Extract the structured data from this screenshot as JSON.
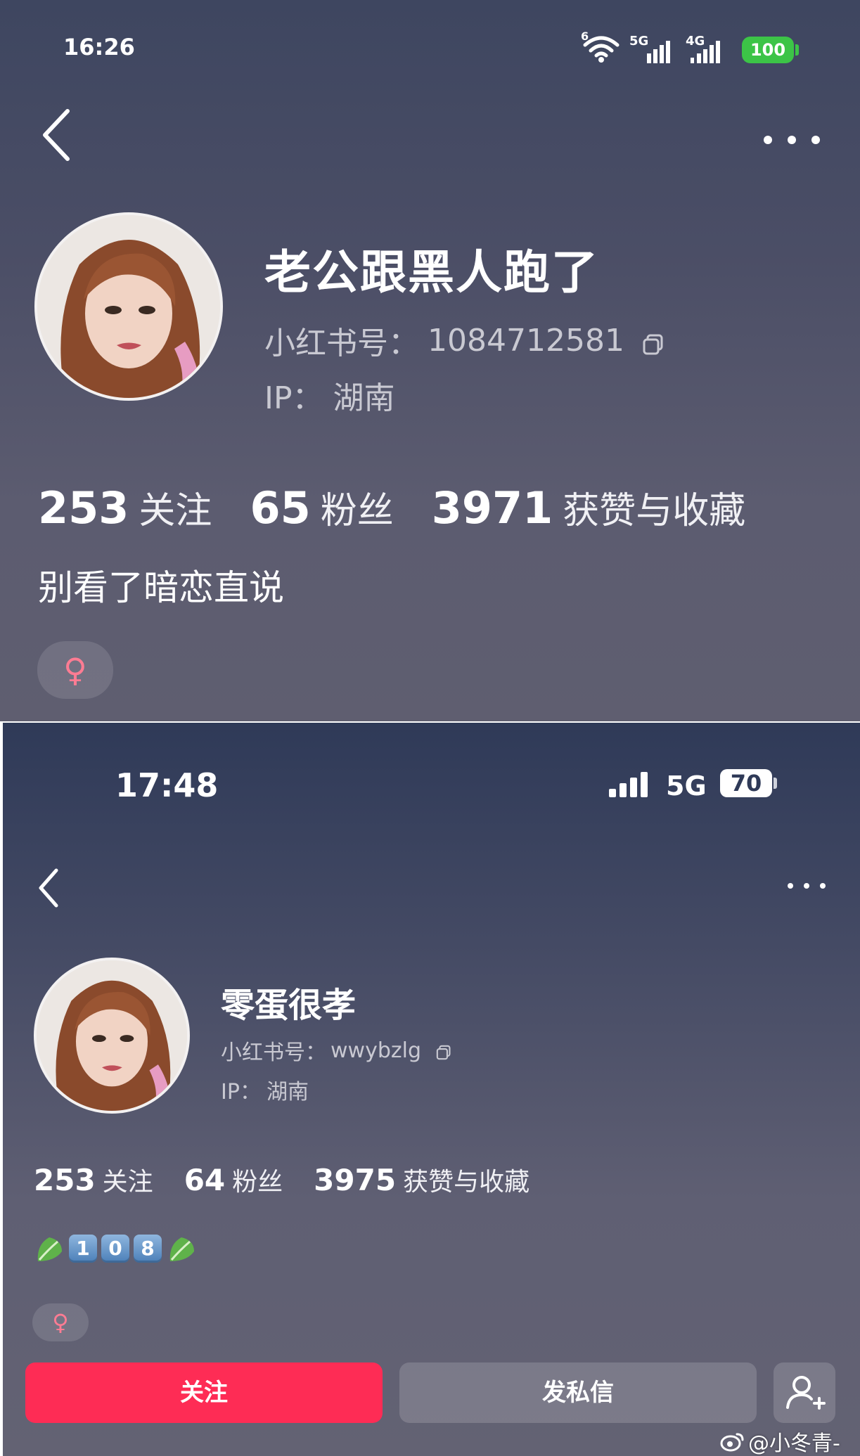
{
  "screen1": {
    "status_time": "16:26",
    "wifi_label": "6",
    "signal1_label": "5G",
    "signal2_label": "4G",
    "battery": "100",
    "nickname": "老公跟黑人跑了",
    "id_label": "小红书号：",
    "id_value": "1084712581",
    "ip_label": "IP：",
    "ip_value": "湖南",
    "following_count": "253",
    "following_label": "关注",
    "fans_count": "65",
    "fans_label": "粉丝",
    "likes_count": "3971",
    "likes_label": "获赞与收藏",
    "bio": "别看了暗恋直说",
    "gender_symbol": "♀"
  },
  "screen2": {
    "status_time": "17:48",
    "network_label": "5G",
    "battery": "70",
    "nickname": "零蛋很孝",
    "id_label": "小红书号：",
    "id_value": "wwybzlg",
    "ip_label": "IP：",
    "ip_value": "湖南",
    "following_count": "253",
    "following_label": "关注",
    "fans_count": "64",
    "fans_label": "粉丝",
    "likes_count": "3975",
    "likes_label": "获赞与收藏",
    "bio_keycaps": [
      "1",
      "0",
      "8"
    ],
    "gender_symbol": "♀",
    "follow_button": "关注",
    "message_button": "发私信"
  },
  "watermark": "@小冬青-",
  "colors": {
    "follow_red": "#fe2c55",
    "battery_green": "#3cc447",
    "female_pink": "#ff7c93"
  }
}
